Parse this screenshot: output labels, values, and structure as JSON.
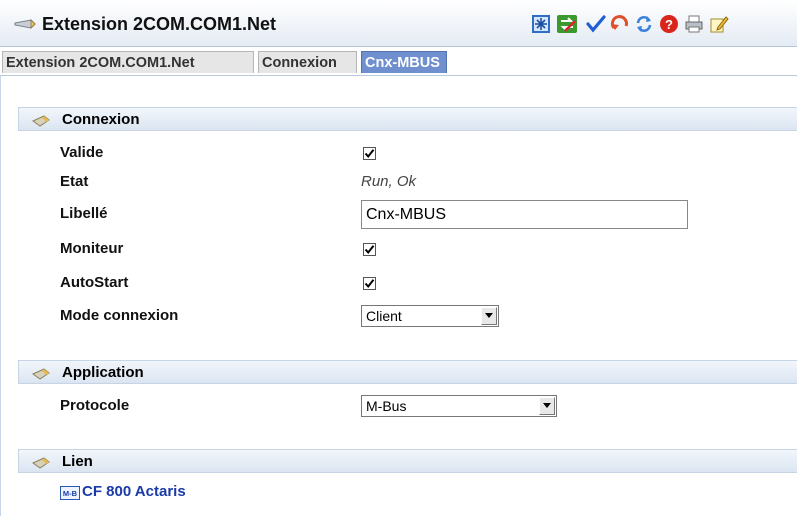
{
  "window": {
    "title": "Extension 2COM.COM1.Net"
  },
  "toolbar": [
    {
      "name": "network-icon"
    },
    {
      "name": "refresh-green-icon"
    },
    {
      "name": "check-icon"
    },
    {
      "name": "undo-icon"
    },
    {
      "name": "reload-icon"
    },
    {
      "name": "help-icon"
    },
    {
      "name": "print-icon"
    },
    {
      "name": "edit-icon"
    }
  ],
  "tabs": [
    {
      "label": "Extension 2COM.COM1.Net",
      "active": false
    },
    {
      "label": "Connexion",
      "active": false
    },
    {
      "label": "Cnx-MBUS",
      "active": true
    }
  ],
  "sections": {
    "connexion": {
      "title": "Connexion",
      "fields": {
        "valide": {
          "label": "Valide",
          "checked": true
        },
        "etat": {
          "label": "Etat",
          "value": "Run, Ok"
        },
        "libelle": {
          "label": "Libellé",
          "value": "Cnx-MBUS"
        },
        "moniteur": {
          "label": "Moniteur",
          "checked": true
        },
        "autostart": {
          "label": "AutoStart",
          "checked": true
        },
        "mode": {
          "label": "Mode connexion",
          "value": "Client"
        }
      }
    },
    "application": {
      "title": "Application",
      "fields": {
        "protocole": {
          "label": "Protocole",
          "value": "M-Bus"
        }
      }
    },
    "lien": {
      "title": "Lien",
      "link": {
        "icon_text": "M-B",
        "label": "CF 800 Actaris"
      }
    }
  },
  "colors": {
    "active_tab": "#6f8fcf",
    "link": "#1a3aa8",
    "section_bg": "#dbe5f1"
  }
}
